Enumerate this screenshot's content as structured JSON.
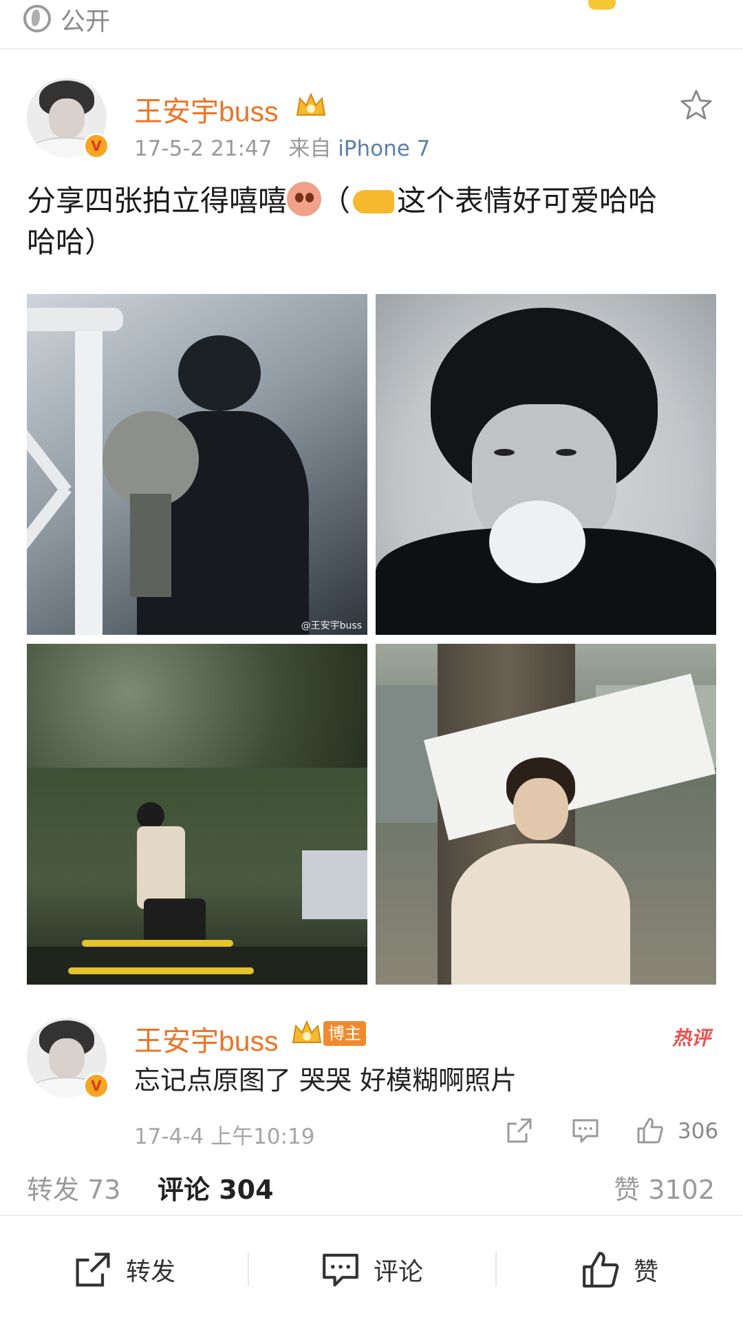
{
  "top": {
    "visibility_label": "公开"
  },
  "post": {
    "author": "王安宇buss",
    "timestamp": "17-5-2 21:47",
    "source_prefix": "来自",
    "source_device": "iPhone 7",
    "text_line1_a": "分享四张拍立得嘻嘻",
    "text_line1_b": "（",
    "text_line1_c": "这个表情好可爱哈哈",
    "text_line2": "哈哈）",
    "watermark": "@王安宇buss"
  },
  "hot_comment": {
    "author": "王安宇buss",
    "badge": "博主",
    "hot_label": "热评",
    "text": "忘记点原图了 哭哭 好模糊啊照片",
    "time": "17-4-4 上午10:19",
    "likes": "306"
  },
  "stats": {
    "repost": "转发 73",
    "comment": "评论 304",
    "like": "赞 3102"
  },
  "actions": {
    "repost": "转发",
    "comment": "评论",
    "like": "赞"
  },
  "colors": {
    "author_orange": "#ee7424",
    "device_blue": "#5b7fa8",
    "hot_red": "#ee4e4e"
  },
  "icons": [
    "globe-icon",
    "crown-icon",
    "star-icon",
    "v-badge-icon",
    "share-icon",
    "comment-icon",
    "thumb-up-icon"
  ]
}
